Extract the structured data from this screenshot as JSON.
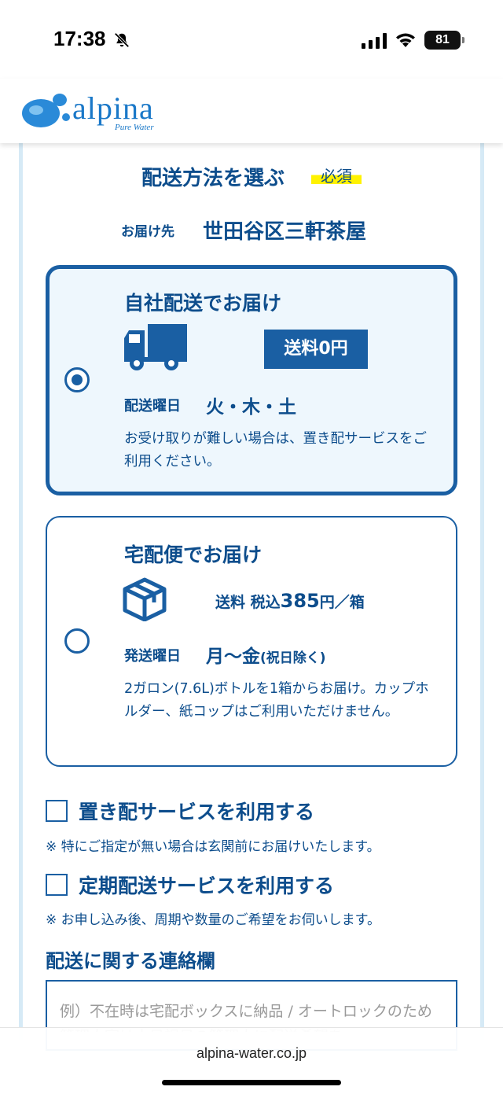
{
  "status_bar": {
    "time": "17:38",
    "battery": "81",
    "icons": [
      "bell-slash-icon",
      "signal-icon",
      "wifi-icon",
      "battery-icon"
    ]
  },
  "header": {
    "logo_text": "alpina",
    "logo_sub": "Pure Water"
  },
  "delivery": {
    "title": "配送方法を選ぶ",
    "required": "必須",
    "destination_label": "お届け先",
    "destination_value": "世田谷区三軒茶屋"
  },
  "options": [
    {
      "title": "自社配送でお届け",
      "selected": true,
      "icon": "truck-icon",
      "fee_badge": "送料0円",
      "day_label": "配送曜日",
      "day_value": "火・木・土",
      "note": "お受け取りが難しい場合は、置き配サービスをご利用ください。"
    },
    {
      "title": "宅配便でお届け",
      "selected": false,
      "icon": "box-icon",
      "fee_prefix": "送料 税込",
      "fee_amount": "385",
      "fee_suffix": "円／箱",
      "day_label": "発送曜日",
      "day_value": "月〜金",
      "day_note": "(祝日除く)",
      "note": "2ガロン(7.6L)ボトルを1箱からお届け。カップホルダー、紙コップはご利用いただけません。"
    }
  ],
  "checkboxes": [
    {
      "label": "置き配サービスを利用する",
      "checked": false,
      "note": "※ 特にご指定が無い場合は玄関前にお届けいたします。"
    },
    {
      "label": "定期配送サービスを利用する",
      "checked": false,
      "note": "※ お申し込み後、周期や数量のご希望をお伺いします。"
    }
  ],
  "contact": {
    "title": "配送に関する連絡欄",
    "placeholder": "例）不在時は宅配ボックスに納品 / オートロックのため管理人室は土日祝日の管理人に配送希望を"
  },
  "browser": {
    "url": "alpina-water.co.jp"
  },
  "colors": {
    "primary": "#1a5fa3",
    "text": "#0d4d8c",
    "card_bg": "#eef7fd",
    "highlight": "#fff200",
    "frame": "#d6eaf6"
  }
}
